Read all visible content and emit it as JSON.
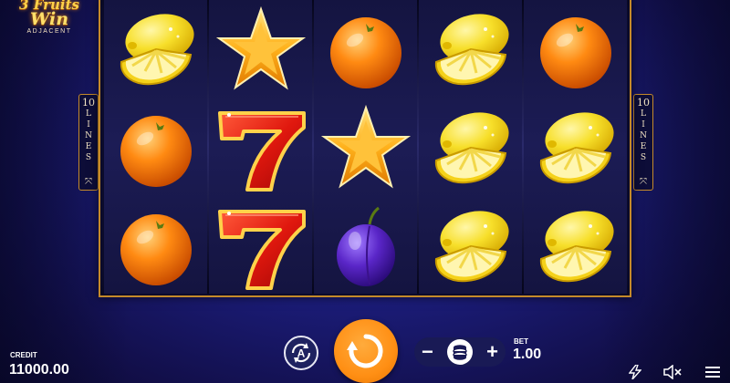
{
  "logo": {
    "line1": "3 Fruits",
    "line2": "Win",
    "line3": "ADJACENT"
  },
  "lines_badge": {
    "number": "10",
    "word": "LINES"
  },
  "reels": [
    [
      "lemon",
      "orange",
      "orange"
    ],
    [
      "star",
      "seven",
      "seven"
    ],
    [
      "orange",
      "star",
      "plum"
    ],
    [
      "lemon",
      "lemon",
      "lemon"
    ],
    [
      "orange",
      "lemon",
      "lemon"
    ]
  ],
  "footer": {
    "credit_label": "CREDIT",
    "credit_value": "11000.00",
    "bet_label": "BET",
    "bet_value": "1.00",
    "minus": "−",
    "plus": "+"
  },
  "icons": {
    "autoplay": "autoplay-icon",
    "spin": "spin-icon",
    "coin": "coins-icon",
    "turbo": "lightning-icon",
    "sound": "sound-muted-icon",
    "menu": "menu-icon"
  },
  "colors": {
    "accent": "#ff8f14",
    "frame": "#c58a2a",
    "background": "#1b1c78"
  }
}
